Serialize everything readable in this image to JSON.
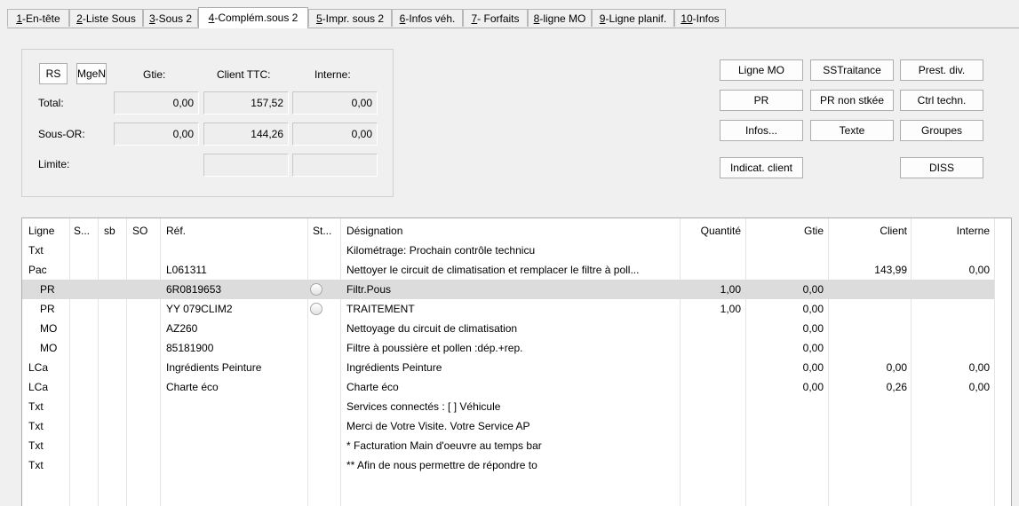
{
  "tabs": [
    {
      "key": "1",
      "label": "-En-tête",
      "active": false
    },
    {
      "key": "2",
      "label": "-Liste Sous",
      "active": false
    },
    {
      "key": "3",
      "label": "-Sous 2",
      "active": false
    },
    {
      "key": "4",
      "label": "-Complém.sous 2",
      "active": true
    },
    {
      "key": "5",
      "label": "-Impr. sous 2",
      "active": false
    },
    {
      "key": "6",
      "label": "-Infos véh.",
      "active": false
    },
    {
      "key": "7",
      "label": "- Forfaits",
      "active": false
    },
    {
      "key": "8",
      "label": "-ligne MO",
      "active": false
    },
    {
      "key": "9",
      "label": "-Ligne planif.",
      "active": false
    },
    {
      "key": "10",
      "label": "-Infos",
      "active": false
    }
  ],
  "totals": {
    "rs_label": "RS",
    "mgen_label": "MgeN",
    "col_gtie": "Gtie:",
    "col_client": "Client TTC:",
    "col_interne": "Interne:",
    "row_total": "Total:",
    "row_sousor": "Sous-OR:",
    "row_limite": "Limite:",
    "total_gtie": "0,00",
    "total_client": "157,52",
    "total_interne": "0,00",
    "sousor_gtie": "0,00",
    "sousor_client": "144,26",
    "sousor_interne": "0,00",
    "limite_client": "",
    "limite_interne": ""
  },
  "actions": {
    "ligne_mo": "Ligne MO",
    "sstraitance": "SSTraitance",
    "prest_div": "Prest. div.",
    "pr": "PR",
    "pr_non_stkee": "PR non stkée",
    "ctrl_techn": "Ctrl techn.",
    "infos": "Infos...",
    "texte": "Texte",
    "groupes": "Groupes",
    "indicat_client": "Indicat. client",
    "diss": "DISS"
  },
  "table": {
    "headers": {
      "ligne": "Ligne",
      "s": "S...",
      "sb": "sb",
      "so": "SO",
      "ref": "Réf.",
      "st": "St...",
      "designation": "Désignation",
      "quantite": "Quantité",
      "gtie": "Gtie",
      "client": "Client",
      "interne": "Interne"
    },
    "rows": [
      {
        "ligne": "Txt",
        "indent": false,
        "ref": "",
        "radio": false,
        "designation": "Kilométrage: Prochain contrôle technicu",
        "quantite": "",
        "gtie": "",
        "client": "",
        "interne": "",
        "selected": false
      },
      {
        "ligne": "Pac",
        "indent": false,
        "ref": "L061311",
        "radio": false,
        "designation": "Nettoyer le circuit de climatisation et remplacer le filtre à poll...",
        "quantite": "",
        "gtie": "",
        "client": "143,99",
        "interne": "0,00",
        "selected": false
      },
      {
        "ligne": "PR",
        "indent": true,
        "ref": "6R0819653",
        "radio": true,
        "designation": "Filtr.Pous",
        "quantite": "1,00",
        "gtie": "0,00",
        "client": "",
        "interne": "",
        "selected": true
      },
      {
        "ligne": "PR",
        "indent": true,
        "ref": "YY 079CLIM2",
        "radio": true,
        "designation": "TRAITEMENT",
        "quantite": "1,00",
        "gtie": "0,00",
        "client": "",
        "interne": "",
        "selected": false
      },
      {
        "ligne": "MO",
        "indent": true,
        "ref": "AZ260",
        "radio": false,
        "designation": "Nettoyage du circuit de climatisation",
        "quantite": "",
        "gtie": "0,00",
        "client": "",
        "interne": "",
        "selected": false
      },
      {
        "ligne": "MO",
        "indent": true,
        "ref": "85181900",
        "radio": false,
        "designation": "Filtre à poussière et pollen :dép.+rep.",
        "quantite": "",
        "gtie": "0,00",
        "client": "",
        "interne": "",
        "selected": false
      },
      {
        "ligne": "LCa",
        "indent": false,
        "ref": "Ingrédients Peinture",
        "radio": false,
        "designation": "Ingrédients Peinture",
        "quantite": "",
        "gtie": "0,00",
        "client": "0,00",
        "interne": "0,00",
        "selected": false
      },
      {
        "ligne": "LCa",
        "indent": false,
        "ref": "Charte éco",
        "radio": false,
        "designation": "Charte éco",
        "quantite": "",
        "gtie": "0,00",
        "client": "0,26",
        "interne": "0,00",
        "selected": false
      },
      {
        "ligne": "Txt",
        "indent": false,
        "ref": "",
        "radio": false,
        "designation": "Services connectés : [    ]     Véhicule",
        "quantite": "",
        "gtie": "",
        "client": "",
        "interne": "",
        "selected": false
      },
      {
        "ligne": "Txt",
        "indent": false,
        "ref": "",
        "radio": false,
        "designation": "Merci de Votre Visite. Votre Service AP",
        "quantite": "",
        "gtie": "",
        "client": "",
        "interne": "",
        "selected": false
      },
      {
        "ligne": "Txt",
        "indent": false,
        "ref": "",
        "radio": false,
        "designation": "* Facturation Main d'oeuvre au temps bar",
        "quantite": "",
        "gtie": "",
        "client": "",
        "interne": "",
        "selected": false
      },
      {
        "ligne": "Txt",
        "indent": false,
        "ref": "",
        "radio": false,
        "designation": "** Afin de nous permettre de répondre to",
        "quantite": "",
        "gtie": "",
        "client": "",
        "interne": "",
        "selected": false
      }
    ]
  }
}
